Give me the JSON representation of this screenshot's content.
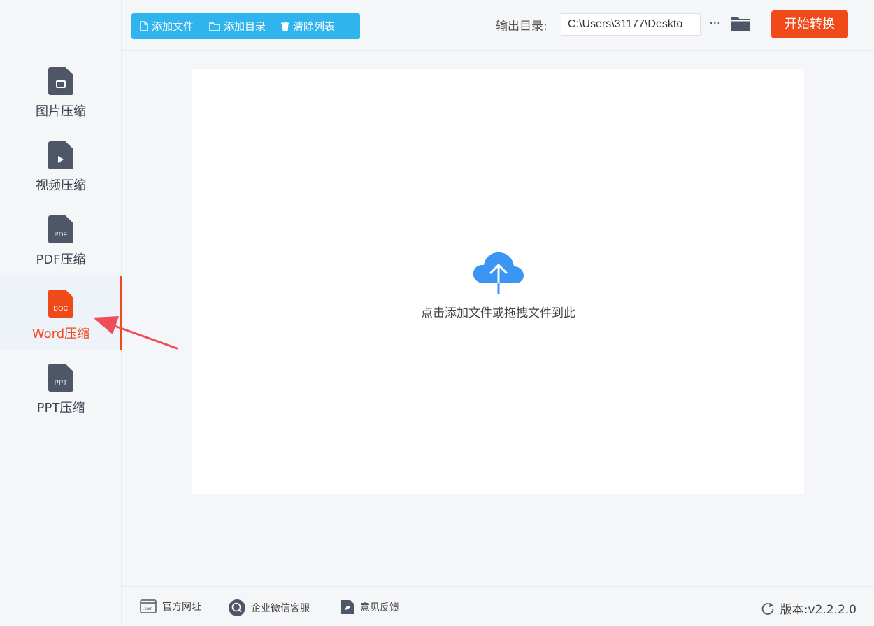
{
  "sidebar": {
    "items": [
      {
        "label": "图片压缩",
        "tag": ""
      },
      {
        "label": "视频压缩",
        "tag": ""
      },
      {
        "label": "PDF压缩",
        "tag": "PDF"
      },
      {
        "label": "Word压缩",
        "tag": "DOC",
        "active": true
      },
      {
        "label": "PPT压缩",
        "tag": "PPT"
      }
    ]
  },
  "toolbar": {
    "add_file": "添加文件",
    "add_folder": "添加目录",
    "clear_list": "清除列表",
    "output_label": "输出目录:",
    "output_path": "C:\\Users\\31177\\Deskto",
    "more": "···",
    "start": "开始转换"
  },
  "dropzone": {
    "hint": "点击添加文件或拖拽文件到此"
  },
  "footer": {
    "website": "官方网址",
    "wechat": "企业微信客服",
    "feedback": "意见反馈",
    "version": "版本:v2.2.2.0"
  },
  "colors": {
    "accent": "#f04a1a",
    "toolbar_blue": "#2fb4ee",
    "cloud_blue": "#3a96f2",
    "icon_gray": "#4f5668"
  }
}
